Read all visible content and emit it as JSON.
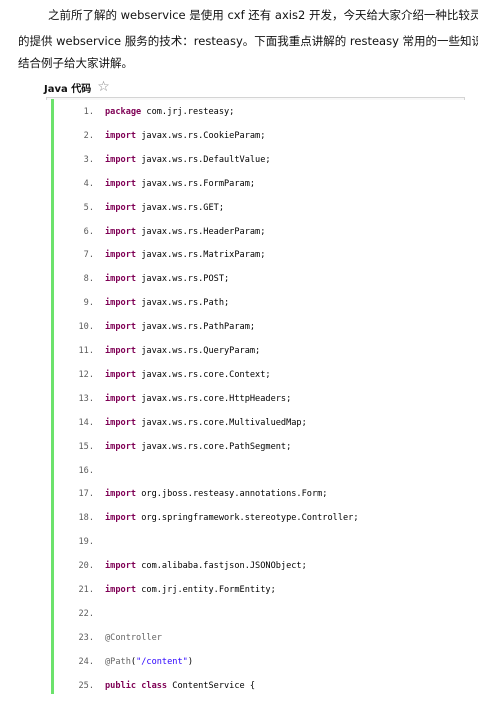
{
  "intro": {
    "line1": "之前所了解的 webservice 是使用 cxf 还有 axis2 开发，今天给大家介绍一种比较灵活",
    "line2": "的提供 webservice 服务的技术：resteasy。下面我重点讲解的 resteasy 常用的一些知识。",
    "line3": "结合例子给大家讲解。"
  },
  "code_header": {
    "label": "Java 代码",
    "star": "☆"
  },
  "code_lines": [
    {
      "num": "1.",
      "kw": "package",
      "rest": " com.jrj.resteasy;"
    },
    {
      "num": "2.",
      "kw": "import",
      "rest": " javax.ws.rs.CookieParam;"
    },
    {
      "num": "3.",
      "kw": "import",
      "rest": " javax.ws.rs.DefaultValue;"
    },
    {
      "num": "4.",
      "kw": "import",
      "rest": " javax.ws.rs.FormParam;"
    },
    {
      "num": "5.",
      "kw": "import",
      "rest": " javax.ws.rs.GET;"
    },
    {
      "num": "6.",
      "kw": "import",
      "rest": " javax.ws.rs.HeaderParam;"
    },
    {
      "num": "7.",
      "kw": "import",
      "rest": " javax.ws.rs.MatrixParam;"
    },
    {
      "num": "8.",
      "kw": "import",
      "rest": " javax.ws.rs.POST;"
    },
    {
      "num": "9.",
      "kw": "import",
      "rest": " javax.ws.rs.Path;"
    },
    {
      "num": "10.",
      "kw": "import",
      "rest": " javax.ws.rs.PathParam;"
    },
    {
      "num": "11.",
      "kw": "import",
      "rest": " javax.ws.rs.QueryParam;"
    },
    {
      "num": "12.",
      "kw": "import",
      "rest": " javax.ws.rs.core.Context;"
    },
    {
      "num": "13.",
      "kw": "import",
      "rest": " javax.ws.rs.core.HttpHeaders;"
    },
    {
      "num": "14.",
      "kw": "import",
      "rest": " javax.ws.rs.core.MultivaluedMap;"
    },
    {
      "num": "15.",
      "kw": "import",
      "rest": " javax.ws.rs.core.PathSegment;"
    },
    {
      "num": "16.",
      "kw": "",
      "rest": ""
    },
    {
      "num": "17.",
      "kw": "import",
      "rest": " org.jboss.resteasy.annotations.Form;"
    },
    {
      "num": "18.",
      "kw": "import",
      "rest": " org.springframework.stereotype.Controller;"
    },
    {
      "num": "19.",
      "kw": "",
      "rest": ""
    },
    {
      "num": "20.",
      "kw": "import",
      "rest": " com.alibaba.fastjson.JSONObject;"
    },
    {
      "num": "21.",
      "kw": "import",
      "rest": " com.jrj.entity.FormEntity;"
    },
    {
      "num": "22.",
      "kw": "",
      "rest": ""
    },
    {
      "num": "23.",
      "ann": "@Controller"
    },
    {
      "num": "24.",
      "ann": "@Path",
      "tail1": "(",
      "str": "\"/content\"",
      "tail2": ")"
    },
    {
      "num": "25.",
      "kw": "public",
      "kw2": " class",
      "rest": " ContentService {"
    }
  ]
}
